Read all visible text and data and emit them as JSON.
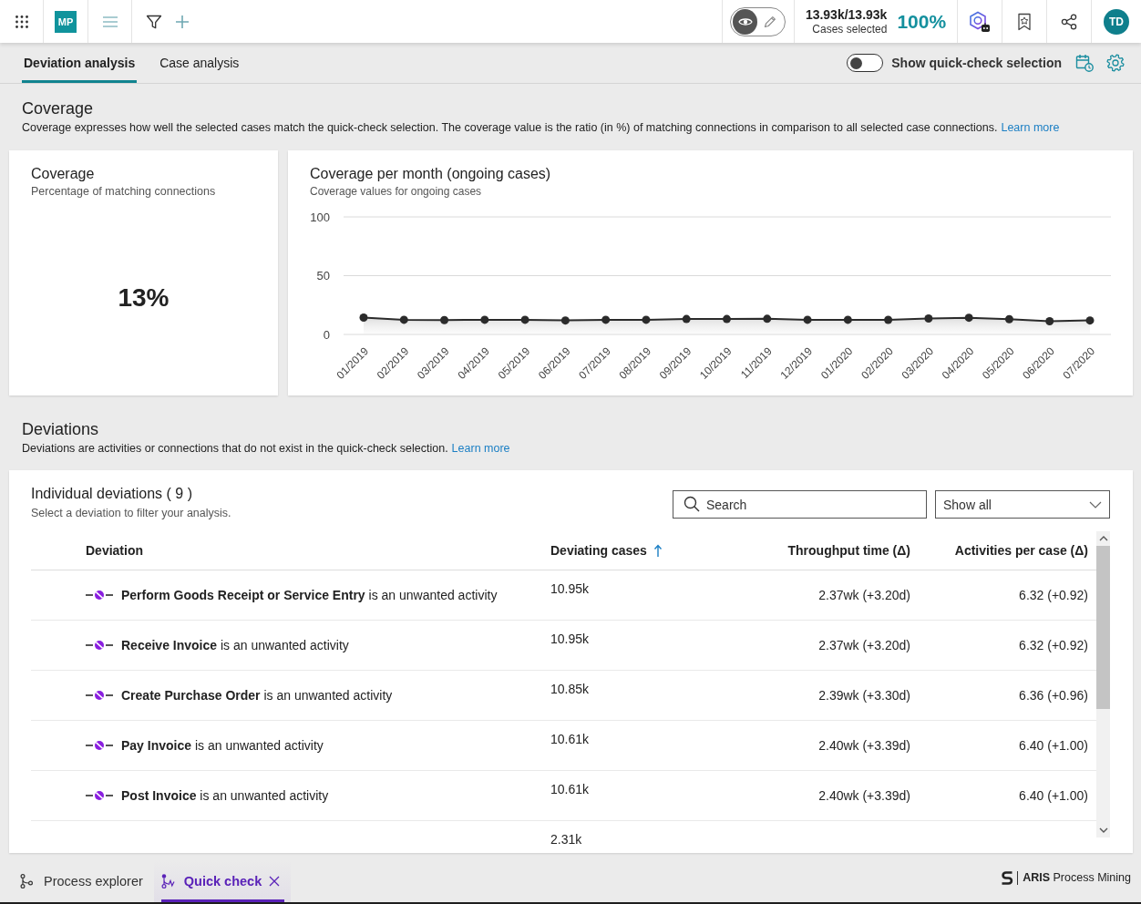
{
  "top_bar": {
    "app_badge": "MP",
    "mode_switch": [
      {
        "kind": "view",
        "selected": true
      },
      {
        "kind": "edit",
        "selected": false
      }
    ],
    "cases_count": "13.93k/13.93k",
    "cases_label": "Cases selected",
    "cases_percent": "100%",
    "avatar": "TD"
  },
  "tabs": [
    {
      "label": "Deviation analysis",
      "selected": true
    },
    {
      "label": "Case analysis",
      "selected": false
    }
  ],
  "quick_check_toggle": {
    "label": "Show quick-check selection",
    "on": false
  },
  "coverage_section": {
    "title": "Coverage",
    "description": "Coverage expresses how well the selected cases match the quick-check selection. The coverage value is the ratio (in %) of matching connections in comparison to all selected case connections.",
    "link": "Learn more"
  },
  "coverage_card": {
    "title": "Coverage",
    "subtitle": "Percentage of matching connections",
    "value": "13%"
  },
  "chart_card": {
    "title": "Coverage per month (ongoing cases)",
    "subtitle": "Coverage values for ongoing cases",
    "chart_data": {
      "type": "area",
      "categories": [
        "01/2019",
        "02/2019",
        "03/2019",
        "04/2019",
        "05/2019",
        "06/2019",
        "07/2019",
        "08/2019",
        "09/2019",
        "10/2019",
        "11/2019",
        "12/2019",
        "01/2020",
        "02/2020",
        "03/2020",
        "04/2020",
        "05/2020",
        "06/2020",
        "07/2020"
      ],
      "values": [
        14.3,
        12.5,
        12.2,
        12.5,
        12.5,
        11.9,
        12.5,
        12.5,
        13.1,
        13.1,
        13.3,
        12.5,
        12.5,
        12.4,
        13.6,
        14.2,
        13.0,
        11.2,
        11.9
      ],
      "ylim": [
        0,
        100
      ],
      "yticks": [
        0,
        50,
        100
      ]
    }
  },
  "deviations_section": {
    "title": "Deviations",
    "description": "Deviations are activities or connections that do not exist in the quick-check selection.",
    "link": "Learn more"
  },
  "deviations_table": {
    "title": "Individual deviations ( 9 )",
    "subtitle": "Select a deviation to filter your analysis.",
    "search": {
      "placeholder": "Search"
    },
    "filter": {
      "value": "Show all"
    },
    "columns": [
      {
        "label": "Deviation",
        "sorted": false
      },
      {
        "label": "Deviating cases",
        "sorted": true,
        "ascending": true
      },
      {
        "label": "Throughput time (Δ)",
        "sorted": false
      },
      {
        "label": "Activities per case (Δ)",
        "sorted": false
      }
    ],
    "rows": [
      {
        "deviation": "**Perform Goods Receipt or Service Entry** is an unwanted activity",
        "deviating_cases": "10.95k",
        "throughput_time": "2.37wk (+3.20d)",
        "activities_per_case": "6.32 (+0.92)"
      },
      {
        "deviation": "**Receive Invoice** is an unwanted activity",
        "deviating_cases": "10.95k",
        "throughput_time": "2.37wk (+3.20d)",
        "activities_per_case": "6.32 (+0.92)"
      },
      {
        "deviation": "**Create Purchase Order** is an unwanted activity",
        "deviating_cases": "10.85k",
        "throughput_time": "2.39wk (+3.30d)",
        "activities_per_case": "6.36 (+0.96)"
      },
      {
        "deviation": "**Pay Invoice** is an unwanted activity",
        "deviating_cases": "10.61k",
        "throughput_time": "2.40wk (+3.39d)",
        "activities_per_case": "6.40 (+1.00)"
      },
      {
        "deviation": "**Post Invoice** is an unwanted activity",
        "deviating_cases": "10.61k",
        "throughput_time": "2.40wk (+3.39d)",
        "activities_per_case": "6.40 (+1.00)"
      },
      {
        "deviating_cases": "2.31k"
      }
    ]
  },
  "bottom_tabs": [
    {
      "kind": "explorer",
      "label": "Process explorer",
      "selected": false,
      "closable": false
    },
    {
      "kind": "check",
      "label": "Quick check",
      "selected": true,
      "closable": true
    }
  ],
  "brand": "**ARIS** Process Mining"
}
